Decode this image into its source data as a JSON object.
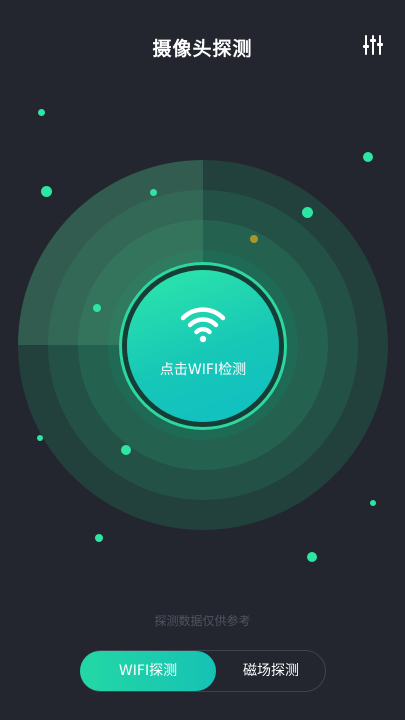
{
  "header": {
    "title": "摄像头探测",
    "settings_icon": "sliders-icon"
  },
  "scan_button": {
    "label": "点击WIFI检测",
    "icon": "wifi-icon"
  },
  "footnote": "探测数据仅供参考",
  "tabs": [
    {
      "label": "WIFI探测",
      "active": true
    },
    {
      "label": "磁场探测",
      "active": false
    }
  ],
  "colors": {
    "accent": "#21d8a2",
    "background": "#23252f",
    "dot_yellow": "#a6962c"
  }
}
